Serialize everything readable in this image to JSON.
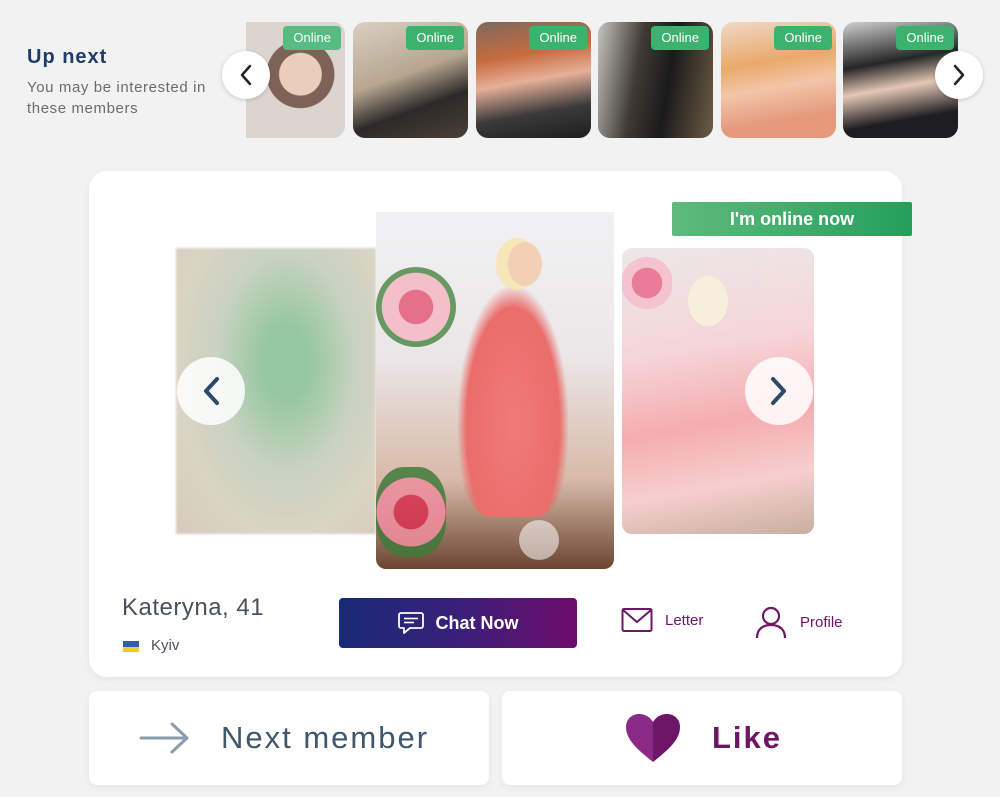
{
  "up_next": {
    "title": "Up next",
    "subtitle": "You may be interested in these members",
    "thumbnails": [
      {
        "badge": "Online"
      },
      {
        "badge": "Online"
      },
      {
        "badge": "Online"
      },
      {
        "badge": "Online"
      },
      {
        "badge": "Online"
      },
      {
        "badge": "Online"
      }
    ]
  },
  "profile": {
    "online_banner": "I'm online now",
    "name_age": "Kateryna, 41",
    "city": "Kyiv",
    "country_flag": "ukraine-flag-icon"
  },
  "actions": {
    "chat_label": "Chat Now",
    "letter_label": "Letter",
    "profile_label": "Profile",
    "next_label": "Next member",
    "like_label": "Like"
  },
  "colors": {
    "online_green": "#3bb36e",
    "brand_purple": "#6d1566",
    "brand_navy": "#192a77",
    "heading_blue": "#1f3d6b"
  }
}
